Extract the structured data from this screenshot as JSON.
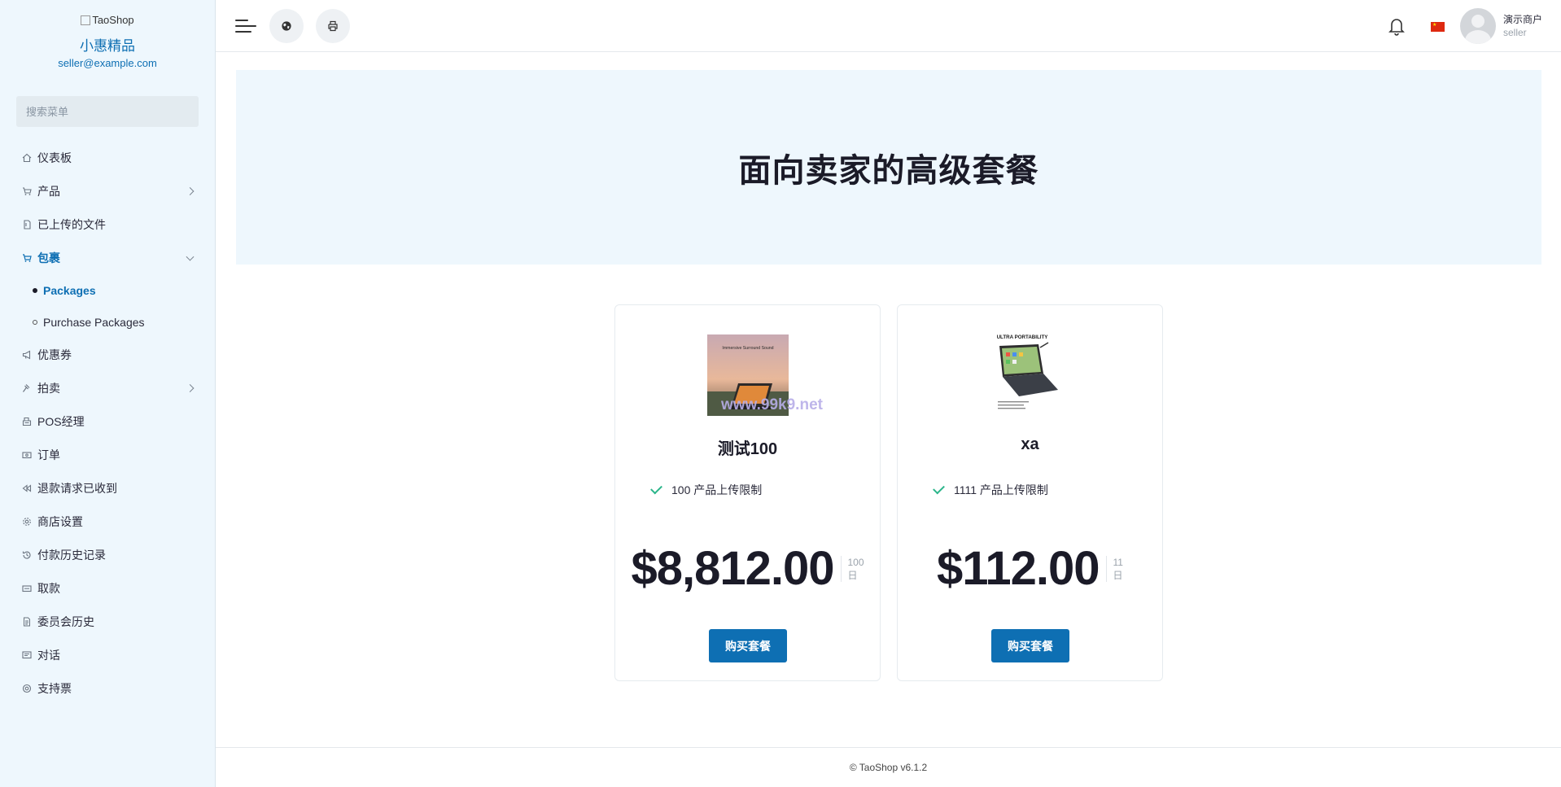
{
  "sidebar": {
    "logo_alt": "TaoShop",
    "shop_name": "小惠精品",
    "email": "seller@example.com",
    "search_placeholder": "搜索菜单",
    "items": [
      {
        "label": "仪表板"
      },
      {
        "label": "产品"
      },
      {
        "label": "已上传的文件"
      },
      {
        "label": "包裹",
        "sub": [
          {
            "label": "Packages"
          },
          {
            "label": "Purchase Packages"
          }
        ]
      },
      {
        "label": "优惠券"
      },
      {
        "label": "拍卖"
      },
      {
        "label": "POS经理"
      },
      {
        "label": "订单"
      },
      {
        "label": "退款请求已收到"
      },
      {
        "label": "商店设置"
      },
      {
        "label": "付款历史记录"
      },
      {
        "label": "取款"
      },
      {
        "label": "委员会历史"
      },
      {
        "label": "对话"
      },
      {
        "label": "支持票"
      }
    ]
  },
  "topbar": {
    "user_name": "演示商户",
    "user_role": "seller",
    "icons": [
      "menu-icon",
      "globe-icon",
      "printer-icon",
      "bell-icon",
      "china-flag-icon"
    ]
  },
  "hero": {
    "title": "面向卖家的高级套餐"
  },
  "packages": [
    {
      "name": "测试100",
      "feature": "100 产品上传限制",
      "price": "$8,812.00",
      "duration_num": "100",
      "duration_unit": "日",
      "button": "购买套餐",
      "image_caption": "Immersive Surround Sound",
      "watermark": "www.99k9.net"
    },
    {
      "name": "xa",
      "feature": "1111 产品上传限制",
      "price": "$112.00",
      "duration_num": "11",
      "duration_unit": "日",
      "button": "购买套餐",
      "image_caption": "ULTRA PORTABILITY"
    }
  ],
  "footer": {
    "text": "© TaoShop v6.1.2"
  },
  "colors": {
    "accent": "#0e6fb3",
    "sidebar_bg": "#eef7fd",
    "check": "#2bb58a"
  }
}
